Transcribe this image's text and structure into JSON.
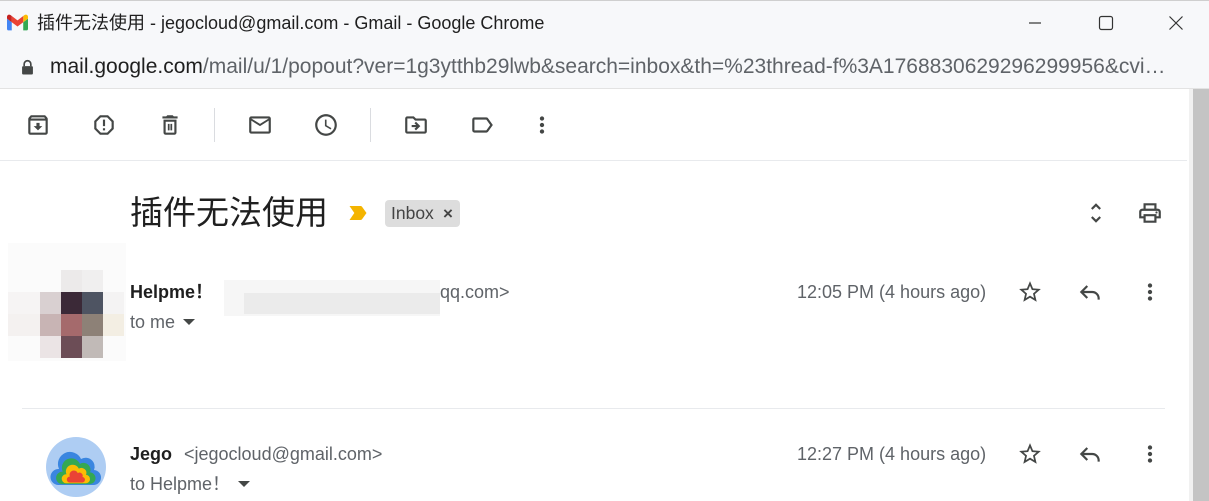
{
  "window": {
    "title": "插件无法使用 - jegocloud@gmail.com - Gmail - Google Chrome",
    "app_icon": "gmail-logo",
    "controls": [
      "minimize-icon",
      "maximize-icon",
      "close-icon"
    ]
  },
  "address_bar": {
    "icon": "lock-icon",
    "host": "mail.google.com",
    "path": "/mail/u/1/popout?ver=1g3ytthb29lwb&search=inbox&th=%23thread-f%3A1768830629296299956&cvi…"
  },
  "toolbar": {
    "buttons": [
      {
        "icon": "archive-icon"
      },
      {
        "icon": "report-spam-icon"
      },
      {
        "icon": "delete-icon"
      },
      {
        "icon": "mark-unread-icon"
      },
      {
        "icon": "snooze-icon"
      },
      {
        "icon": "move-to-icon"
      },
      {
        "icon": "label-icon"
      },
      {
        "icon": "more-vert-icon"
      }
    ]
  },
  "thread": {
    "subject": "插件无法使用",
    "important_icon": "important-marker-icon",
    "label": "Inbox",
    "label_remove": "×",
    "actions": [
      "expand-all-icon",
      "print-icon"
    ]
  },
  "messages": [
    {
      "sender_name": "Helpme！",
      "sender_email_visible": "qq.com>",
      "recipients": "to me",
      "time": "12:05 PM (4 hours ago)",
      "actions": [
        "star-icon",
        "reply-icon",
        "more-vert-icon"
      ]
    },
    {
      "sender_name": "Jego",
      "sender_email": "<jegocloud@gmail.com>",
      "recipients": "to Helpme！",
      "time": "12:27 PM (4 hours ago)",
      "avatar_icon": "cloud-logo-icon",
      "actions": [
        "star-icon",
        "reply-icon",
        "more-vert-icon"
      ]
    }
  ],
  "colors": {
    "text_primary": "#1f1f1f",
    "text_secondary": "#5f6368",
    "icon": "#444746",
    "label_chip_bg": "#dddddd",
    "important_marker": "#f4b400"
  }
}
